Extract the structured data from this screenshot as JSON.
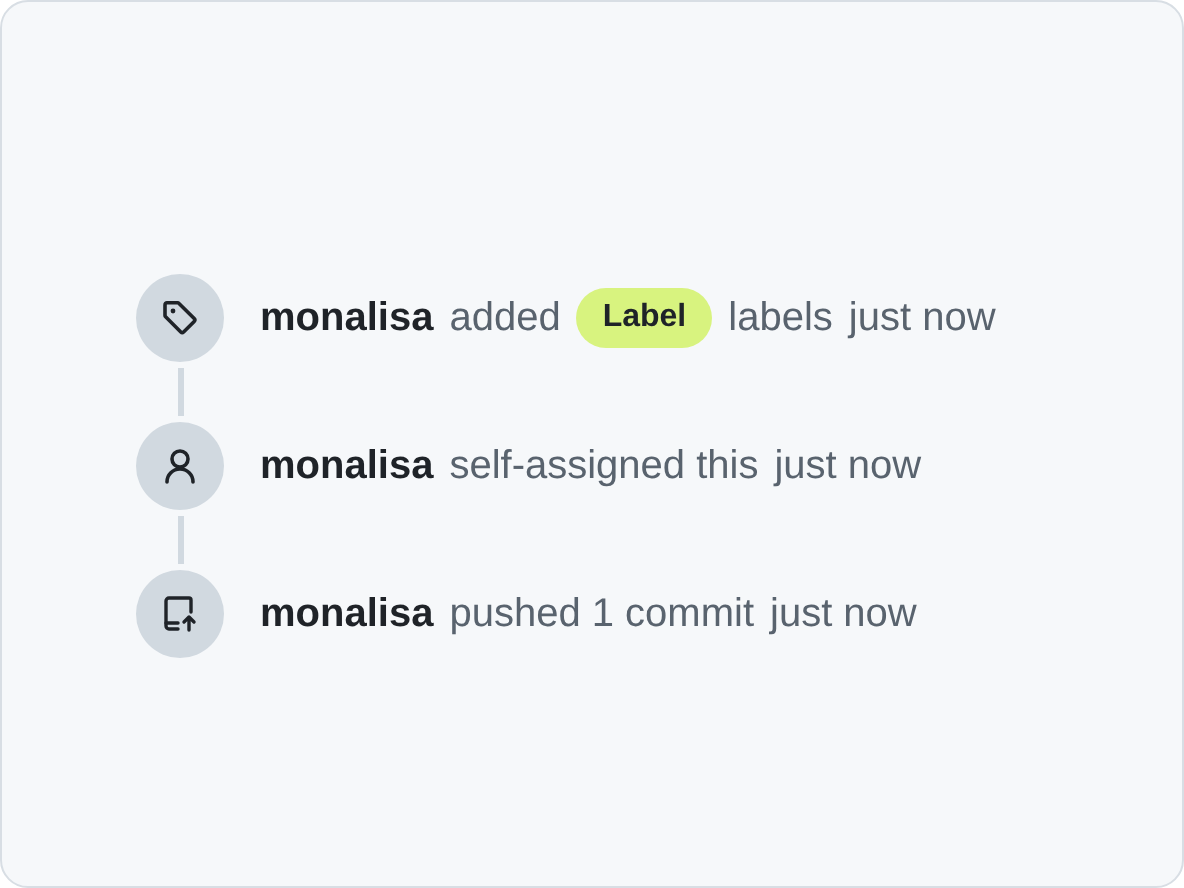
{
  "events": [
    {
      "kind": "label",
      "actor": "monalisa",
      "action": "added",
      "label": "Label",
      "after": "labels",
      "time": "just now"
    },
    {
      "kind": "assign",
      "actor": "monalisa",
      "action": "self-assigned this",
      "time": "just now"
    },
    {
      "kind": "push",
      "actor": "monalisa",
      "action": "pushed 1 commit",
      "time": "just now"
    }
  ]
}
